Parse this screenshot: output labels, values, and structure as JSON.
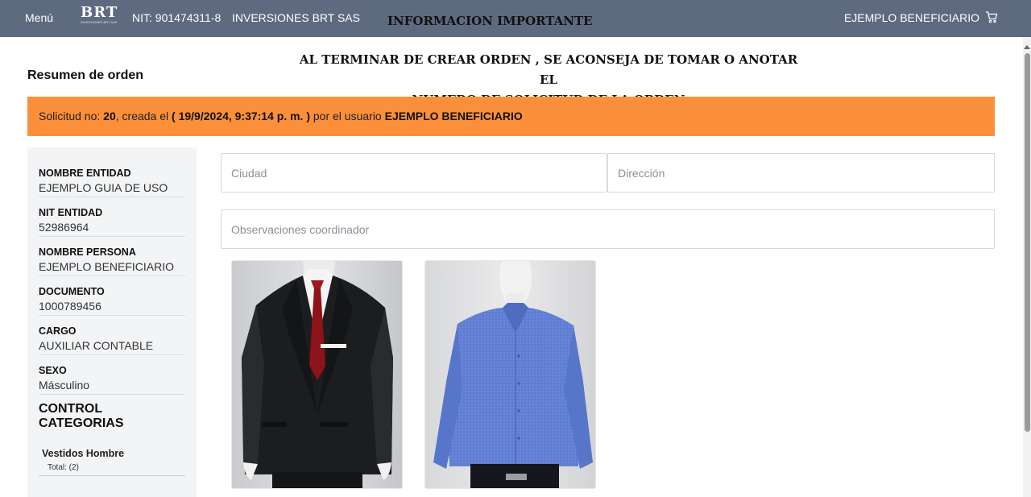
{
  "header": {
    "menu_label": "Menú",
    "logo_text": "BRT",
    "logo_subtext": "INVERSIONES BRT SAS",
    "nit": "NIT: 901474311-8",
    "company": "INVERSIONES BRT SAS",
    "info_title": "INFORMACION IMPORTANTE",
    "user": "EJEMPLO BENEFICIARIO",
    "cart_icon": "cart-icon"
  },
  "notice": {
    "line1": "AL TERMINAR DE CREAR ORDEN , SE ACONSEJA DE TOMAR O ANOTAR EL",
    "line2": "NUMERO DE SOLICITUD DE LA ORDEN"
  },
  "summary_title": "Resumen de orden",
  "banner": {
    "prefix": "Solicitud no: ",
    "number": "20",
    "middle": ", creada el ",
    "date": "( 19/9/2024, 9:37:14 p. m. )",
    "by": " por el usuario ",
    "user": "EJEMPLO BENEFICIARIO",
    "color": "#fc8f3a"
  },
  "sidebar": {
    "fields": [
      {
        "label": "NOMBRE ENTIDAD",
        "value": "EJEMPLO GUIA DE USO"
      },
      {
        "label": "NIT ENTIDAD",
        "value": "52986964"
      },
      {
        "label": "NOMBRE PERSONA",
        "value": "EJEMPLO BENEFICIARIO"
      },
      {
        "label": "DOCUMENTO",
        "value": "1000789456"
      },
      {
        "label": "CARGO",
        "value": "AUXILIAR CONTABLE"
      },
      {
        "label": "SEXO",
        "value": "Másculino"
      }
    ],
    "categories_title": "CONTROL CATEGORIAS",
    "categories": [
      {
        "name": "Vestidos Hombre",
        "total": "Total: (2)"
      }
    ]
  },
  "form": {
    "city_placeholder": "Ciudad",
    "address_placeholder": "Dirección",
    "observations_placeholder": "Observaciones coordinador"
  },
  "products": [
    {
      "image": "suit-jacket-image"
    },
    {
      "image": "blue-shirt-image"
    }
  ]
}
